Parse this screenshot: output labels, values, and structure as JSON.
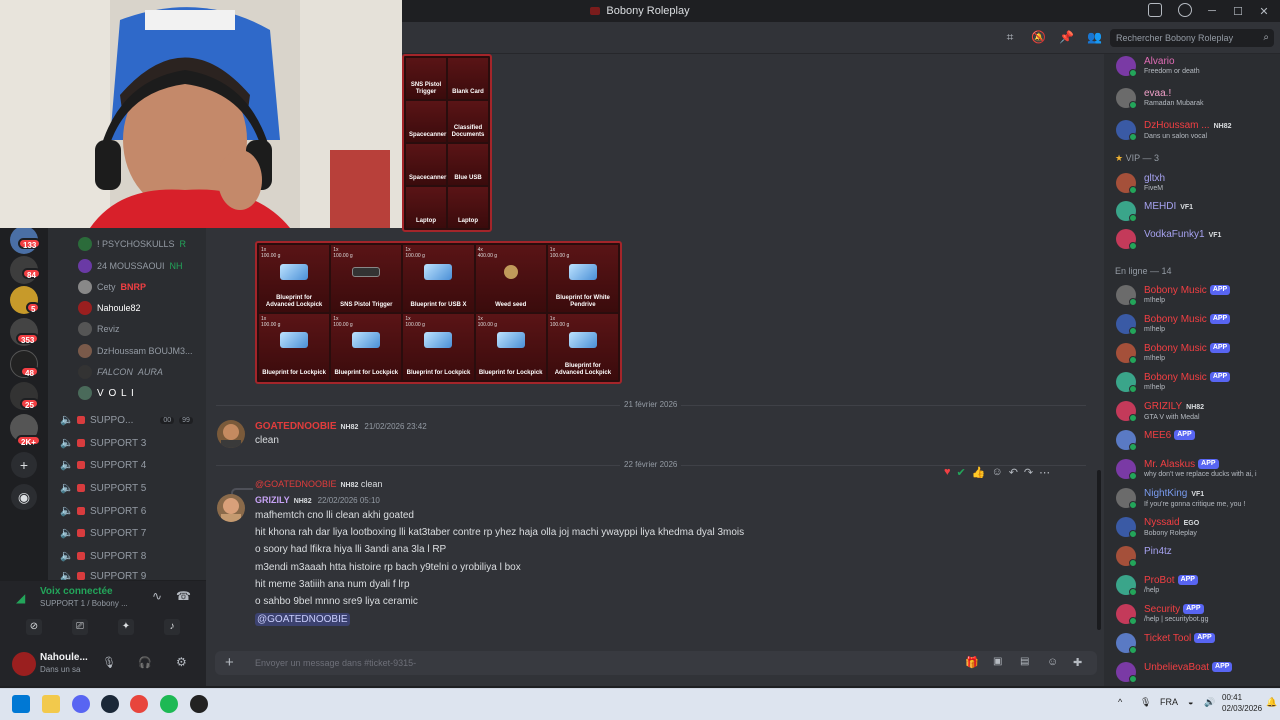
{
  "window": {
    "title": "Bobony Roleplay"
  },
  "search": {
    "placeholder": "Rechercher Bobony Roleplay"
  },
  "servers": {
    "badges": [
      "133",
      "84",
      "5",
      "353",
      "48",
      "25",
      "2K+"
    ]
  },
  "channel_members": [
    {
      "name": "! PSYCHOSKULLS",
      "tag": "R"
    },
    {
      "name": "24 MOUSSAOUI",
      "tag": "NH"
    },
    {
      "name": "Cety",
      "tag": "BNRP"
    },
    {
      "name": "Nahoule82",
      "tag": ""
    },
    {
      "name": "Reviz",
      "tag": ""
    },
    {
      "name": "DzHoussam BOUJM3...",
      "tag": ""
    },
    {
      "name": "FALCON",
      "tag": "AURA"
    },
    {
      "name": "V O L I",
      "tag": ""
    }
  ],
  "channels": [
    {
      "name": "SUPPO...",
      "counts": [
        "00",
        "99"
      ]
    },
    {
      "name": "SUPPORT 3"
    },
    {
      "name": "SUPPORT 4"
    },
    {
      "name": "SUPPORT 5"
    },
    {
      "name": "SUPPORT 6"
    },
    {
      "name": "SUPPORT 7"
    },
    {
      "name": "SUPPORT 8"
    },
    {
      "name": "SUPPORT 9"
    }
  ],
  "voice": {
    "status": "Voix connectée",
    "channel": "SUPPORT 1 / Bobony ..."
  },
  "user": {
    "name": "Nahoule...",
    "status": "Dans un sa"
  },
  "inventory_top": {
    "items": [
      "SNS Pistol Trigger",
      "Blank Card",
      "Spacecanner",
      "Classified Documents",
      "Spacecanner",
      "Blue USB",
      "Laptop",
      "Laptop"
    ]
  },
  "inventory_main": {
    "items": [
      {
        "qty": "1x",
        "weight": "100.00 g",
        "name": "Blueprint for Advanced Lockpick",
        "kind": "bp"
      },
      {
        "qty": "1x",
        "weight": "100.00 g",
        "name": "SNS Pistol Trigger",
        "kind": "gun"
      },
      {
        "qty": "1x",
        "weight": "100.00 g",
        "name": "Blueprint for USB X",
        "kind": "bp"
      },
      {
        "qty": "4x",
        "weight": "400.00 g",
        "name": "Weed seed",
        "kind": "seed"
      },
      {
        "qty": "1x",
        "weight": "100.00 g",
        "name": "Blueprint for White Pendrive",
        "kind": "bp"
      },
      {
        "qty": "1x",
        "weight": "100.00 g",
        "name": "Blueprint for Lockpick",
        "kind": "bp"
      },
      {
        "qty": "1x",
        "weight": "100.00 g",
        "name": "Blueprint for Lockpick",
        "kind": "bp"
      },
      {
        "qty": "1x",
        "weight": "100.00 g",
        "name": "Blueprint for Lockpick",
        "kind": "bp"
      },
      {
        "qty": "1x",
        "weight": "100.00 g",
        "name": "Blueprint for Lockpick",
        "kind": "bp"
      },
      {
        "qty": "1x",
        "weight": "100.00 g",
        "name": "Blueprint for Advanced Lockpick",
        "kind": "bp"
      }
    ]
  },
  "dates": {
    "d1": "21 février 2026",
    "d2": "22 février 2026"
  },
  "msg1": {
    "author": "GOATEDNOOBIE",
    "tag": "NH82",
    "time": "21/02/2026 23:42",
    "text": "clean"
  },
  "msg2": {
    "reply_author": "@GOATEDNOOBIE",
    "reply_tag": "NH82",
    "reply_text": "clean",
    "author": "GRIZILY",
    "tag": "NH82",
    "time": "22/02/2026 05:10",
    "lines": [
      "mafhemtch cno lli clean akhi goated",
      "hit khona rah dar liya lootboxing lli kat3taber contre rp yhez haja olla joj machi ywayppi liya khedma dyal 3mois",
      "o soory had lfikra hiya lli 3andi ana 3la l RP",
      "m3endi m3aaah htta histoire rp bach y9telni o yrobiliya l box",
      "hit meme 3atiiih ana num dyali f lrp",
      "o sahbo 9bel mnno sre9 liya ceramic"
    ],
    "mention": "@GOATEDNOOBIE"
  },
  "composer": {
    "placeholder": "Envoyer un message dans #ticket-9315-"
  },
  "members": {
    "top": [
      {
        "name": "Alvario",
        "status": "Freedom or death",
        "color": "#e06cb5",
        "tag": ""
      },
      {
        "name": "evaa.!",
        "status": "Ramadan Mubarak",
        "color": "#f0a0c8",
        "tag": ""
      },
      {
        "name": "DzHoussam ...",
        "status": "Dans un salon vocal",
        "color": "#f23f43",
        "tag": "NH82"
      }
    ],
    "vip_label": "VIP — 3",
    "vip": [
      {
        "name": "gltxh",
        "status": "FiveM",
        "color": "#a6a2f0",
        "tag": ""
      },
      {
        "name": "MEHDI",
        "status": "",
        "color": "#a6a2f0",
        "tag": "VF1"
      },
      {
        "name": "VodkaFunky1",
        "status": "",
        "color": "#a6a2f0",
        "tag": "VF1"
      }
    ],
    "online_label": "En ligne — 14",
    "online": [
      {
        "name": "Bobony Music",
        "status": "m!help",
        "color": "#f23f43",
        "app": "APP",
        "tag": ""
      },
      {
        "name": "Bobony Music",
        "status": "m!help",
        "color": "#f23f43",
        "app": "APP",
        "tag": ""
      },
      {
        "name": "Bobony Music",
        "status": "m!help",
        "color": "#f23f43",
        "app": "APP",
        "tag": ""
      },
      {
        "name": "Bobony Music",
        "status": "m!help",
        "color": "#f23f43",
        "app": "APP",
        "tag": ""
      },
      {
        "name": "GRIZILY",
        "status": "GTA V with Medal",
        "color": "#f23f43",
        "app": "",
        "tag": "NH82"
      },
      {
        "name": "MEE6",
        "status": "",
        "color": "#f23f43",
        "app": "APP",
        "tag": ""
      },
      {
        "name": "Mr. Alaskus",
        "status": "why don't we replace ducks with ai, i",
        "color": "#f23f43",
        "app": "APP",
        "tag": ""
      },
      {
        "name": "NightKing",
        "status": "If you're gonna critique me, you !",
        "color": "#7a9cf0",
        "app": "",
        "tag": "VF1"
      },
      {
        "name": "Nyssaid",
        "status": "Bobony Roleplay",
        "color": "#f23f43",
        "app": "",
        "tag": "EGO"
      },
      {
        "name": "Pin4tz",
        "status": "",
        "color": "#a6a2f0",
        "app": "",
        "tag": ""
      },
      {
        "name": "ProBot",
        "status": "/help",
        "color": "#f23f43",
        "app": "APP",
        "tag": ""
      },
      {
        "name": "Security",
        "status": "/help | securitybot.gg",
        "color": "#f23f43",
        "app": "APP",
        "tag": ""
      },
      {
        "name": "Ticket Tool",
        "status": "",
        "color": "#f23f43",
        "app": "APP",
        "tag": ""
      },
      {
        "name": "UnbelievaBoat",
        "status": "",
        "color": "#f23f43",
        "app": "APP",
        "tag": ""
      }
    ]
  },
  "taskbar": {
    "lang": "FRA",
    "time": "00:41",
    "date": "02/03/2026"
  },
  "colors": {
    "accent": "#5865f2",
    "danger": "#f23f43",
    "bg": "#313338"
  }
}
